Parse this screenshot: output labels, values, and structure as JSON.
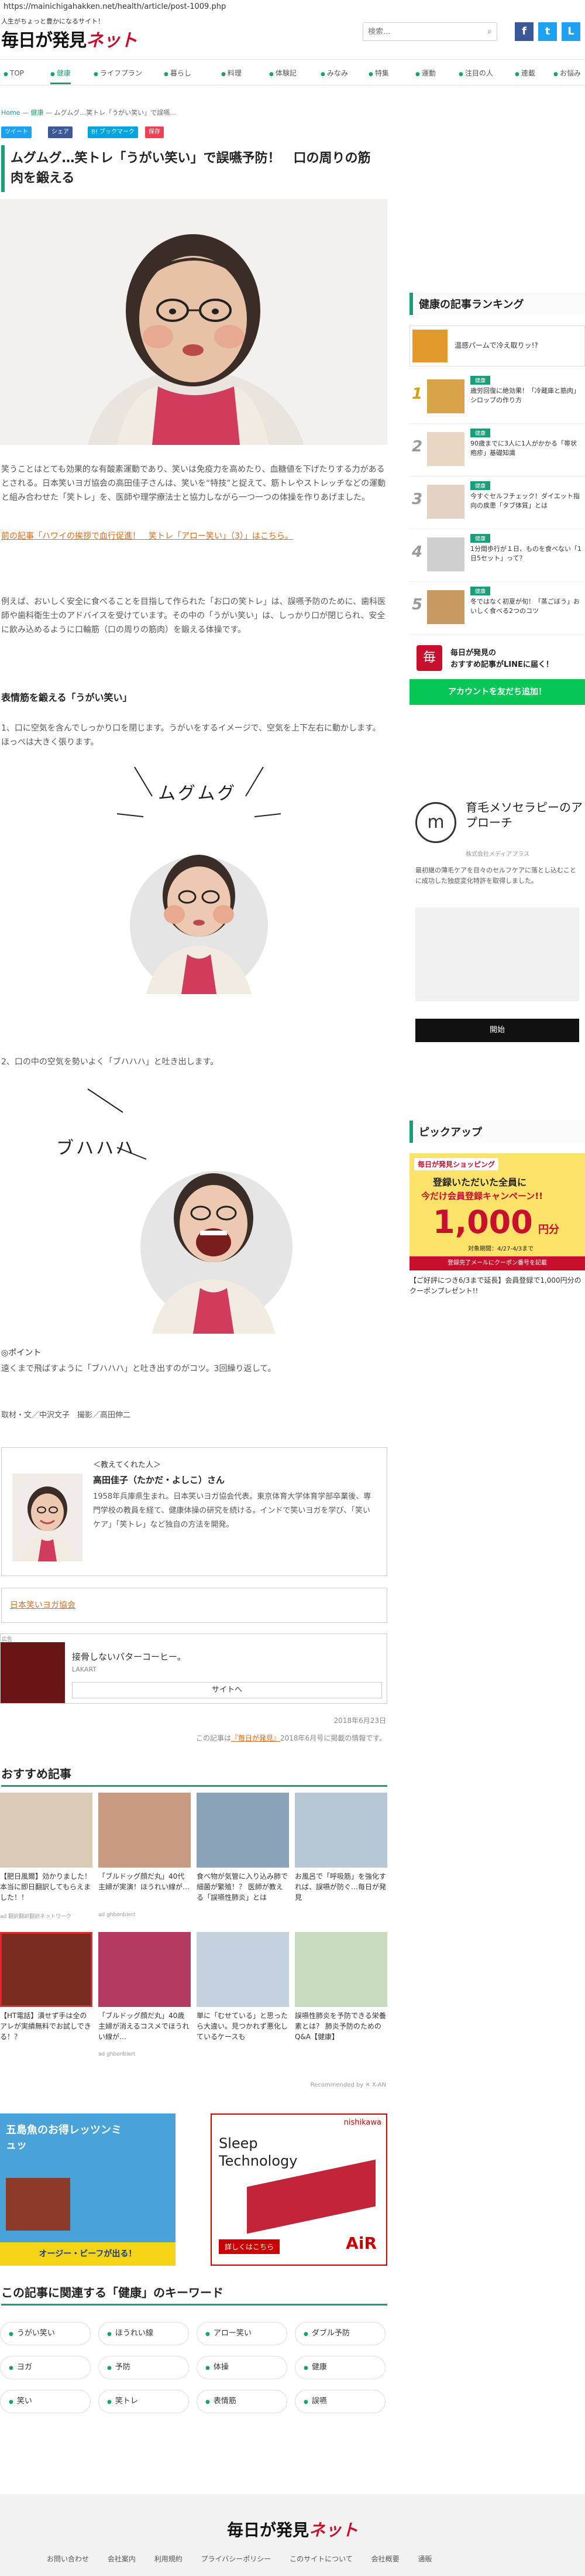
{
  "browser": {
    "url": "https://mainichigahakken.net/health/article/post-1009.php"
  },
  "header": {
    "tagline": "人生がちょっと豊かになるサイト！",
    "logo_main": "毎日が発見",
    "logo_net": "ネット",
    "search_placeholder": "検索...",
    "social": {
      "facebook": "f",
      "twitter": "t",
      "line": "L"
    }
  },
  "nav": {
    "items": [
      {
        "label": "TOP"
      },
      {
        "label": "健康"
      },
      {
        "label": "ライフプラン"
      },
      {
        "label": "暮らし"
      },
      {
        "label": "料理"
      },
      {
        "label": "体験記"
      },
      {
        "label": "みなみ"
      },
      {
        "label": "特集"
      },
      {
        "label": "運動"
      },
      {
        "label": "注目の人"
      },
      {
        "label": "連載"
      },
      {
        "label": "お悩み"
      }
    ]
  },
  "breadcrumb": {
    "home": "Home",
    "sep": "—",
    "category": "健康",
    "current": "ムグムグ…笑トレ「うがい笑い」で誤嚥..."
  },
  "share": {
    "tweet": "ツイート",
    "facebook": "シェア",
    "hatena": "B! ブックマーク",
    "pocket": "保存"
  },
  "article": {
    "title": "ムグムグ…笑トレ「うがい笑い」で誤嚥予防！　口の周りの筋肉を鍛える",
    "p1": "笑うことはとても効果的な有酸素運動であり、笑いは免疫力を高めたり、血糖値を下げたりする力があるとされる。日本笑いヨガ協会の高田佳子さんは、笑いを“特技”と捉えて、筋トレやストレッチなどの運動と組み合わせた「笑トレ」を、医師や理学療法士と協力しながら一つ一つの体操を作りあげました。",
    "prev_link": "前の記事「ハワイの挨拶で血行促進！　笑トレ「アロー笑い」（3）」はこちら。",
    "p2": "例えば、おいしく安全に食べることを目指して作られた「お口の笑トレ」は、誤嚥予防のために、歯科医師や歯科衛生士のアドバイスを受けています。その中の「うがい笑い」は、しっかり口が閉じられ、安全に飲み込めるように口輪筋（口の周りの筋肉）を鍛える体操です。",
    "section_h": "表情筋を鍛える「うがい笑い」",
    "step1": "1、口に空気を含んでしっかり口を閉じます。うがいをするイメージで、空気を上下左右に動かします。ほっぺは大きく張ります。",
    "illus1_text": "ムグムグ",
    "step2": "2、口の中の空気を勢いよく「ブハハハ」と吐き出します。",
    "illus2_text": "ブハハハ",
    "point_h": "◎ポイント",
    "point_text": "遠くまで飛ばすように「ブハハハ」と吐き出すのがコツ。3回繰り返して。",
    "credit": "取材・文／中沢文子　撮影／高田伸二"
  },
  "profile": {
    "lead": "＜教えてくれた人＞",
    "name": "高田佳子（たかだ・よしこ）さん",
    "bio": "1958年兵庫県生まれ。日本笑いヨガ協会代表。東京体育大学体育学部卒業後、専門学校の教員を経て、健康体操の研究を続ける。インドで笑いヨガを学び、「笑いケア」「笑トレ」など独自の方法を開発。"
  },
  "links_box": {
    "label": "日本笑いヨガ協会"
  },
  "ad_inline": {
    "badge": "広告",
    "title": "接骨しないパターコーヒー。",
    "sub": "LAKART",
    "button": "サイトへ"
  },
  "meta": {
    "date": "2018年6月23日",
    "footnote_pre": "この記事は",
    "footnote_link": "『毎日が発見』",
    "footnote_post": "2018年6月号に掲載の情報です。"
  },
  "recommend": {
    "heading": "おすすめ記事",
    "cards": [
      {
        "text": "【肥日風爾】効かりました！本当に即日翻訳してもらえました！！",
        "src": "ad 翻訳翻訳翻訳ネットワーク"
      },
      {
        "text": "「ブルドッグ顔だ丸」40代主婦が実演！ほうれい線が…",
        "src": "ad ghbonbiert"
      },
      {
        "text": "食べ物が気管に入り込み肺で細菌が繁殖！？ 医師が教える「誤嚥性肺炎」とは",
        "src": ""
      },
      {
        "text": "お風呂で「呼吸筋」を強化すれば、誤嚥が防ぐ…毎日が発見",
        "src": ""
      },
      {
        "text": "【HT電話】潰せず手は全のアレが実績無料でお試しできる！？",
        "src": ""
      },
      {
        "text": "「ブルドッグ顔だ丸」40歳主婦が消えるコスメでほうれい線が…",
        "src": "ad ghbonbiert"
      },
      {
        "text": "単に「むせている」と思ったら大違い。見つかれず悪化しているケースも",
        "src": ""
      },
      {
        "text": "誤嚥性肺炎を予防できる栄養素とは？ 肺炎予防のためのQ&A【健康】",
        "src": ""
      }
    ],
    "by": "Recommended by ✕ X-AN"
  },
  "ad_big": {
    "left_title": "五島魚のお得レッツンミュッ",
    "left_button": "オージー・ビーフが出る！",
    "right_brand": "nishikawa",
    "right_title": "Sleep Technology",
    "right_sub": "AiR",
    "right_button": "詳しくはこちら"
  },
  "keywords": {
    "heading": "この記事に関連する「健康」のキーワード",
    "items": [
      "うがい笑い",
      "ほうれい線",
      "アロー笑い",
      "ダブル予防",
      "ヨガ",
      "予防",
      "体操",
      "健康",
      "笑い",
      "笑トレ",
      "表情筋",
      "誤嚥"
    ]
  },
  "footer": {
    "logo_main": "毎日が発見",
    "logo_net": "ネット",
    "links": [
      "お問い合わせ",
      "会社案内",
      "利用規約",
      "プライバシーポリシー",
      "このサイトについて",
      "会社概要",
      "通販"
    ]
  },
  "sidebar": {
    "ranking_heading": "健康の記事ランキング",
    "top_ad": "温感パームで冷え取りッ!?",
    "ranks": [
      {
        "num": "1",
        "tag": "健康",
        "text": "歳労回復に絶効果！「冷蔵庫と筋肉」シロップの作り方"
      },
      {
        "num": "2",
        "tag": "健康",
        "text": "90歳までに3人に1人がかかる「帯状疱疹」基礎知識"
      },
      {
        "num": "3",
        "tag": "健康",
        "text": "今すぐセルフチェック！ダイエット指向の疾患「タブ体質」とは"
      },
      {
        "num": "4",
        "tag": "健康",
        "text": "1分間歩行が１日、ものを食べない「1日5セット」って？"
      },
      {
        "num": "5",
        "tag": "健康",
        "text": "冬ではなく初夏が旬！「蒸ごぼう」おいしく食べる2つのコツ"
      }
    ],
    "line_promo_title": "毎日が発見の",
    "line_promo_sub": "おすすめ記事がLINEに届く！",
    "line_button": "アカウントを友だち追加！",
    "ad2_title": "育毛メソセラピーのアプローチ",
    "ad2_sub": "株式会社メディアプラス",
    "ad2_text": "最初継の薄毛ケアを目々のセルフケアに落とし込むことに成功した独症変化特許を取得しました。",
    "ad2_button": "開始",
    "pickup_heading": "ピックアップ",
    "pickup_banner_title": "毎日が発見ショッピング",
    "pickup_banner_line1": "登録いただいた全員に",
    "pickup_banner_line2": "今だけ会員登録キャンペーン!!",
    "pickup_banner_amount": "1,000",
    "pickup_banner_unit": "円分",
    "pickup_banner_period": "対象期間：4/27-4/3まで",
    "pickup_banner_note": "登録完了メールにクーポン番号を記載",
    "pickup_caption": "【ご好評につき6/3まで延長】会員登録で1,000円分のクーポンプレゼント!!"
  }
}
